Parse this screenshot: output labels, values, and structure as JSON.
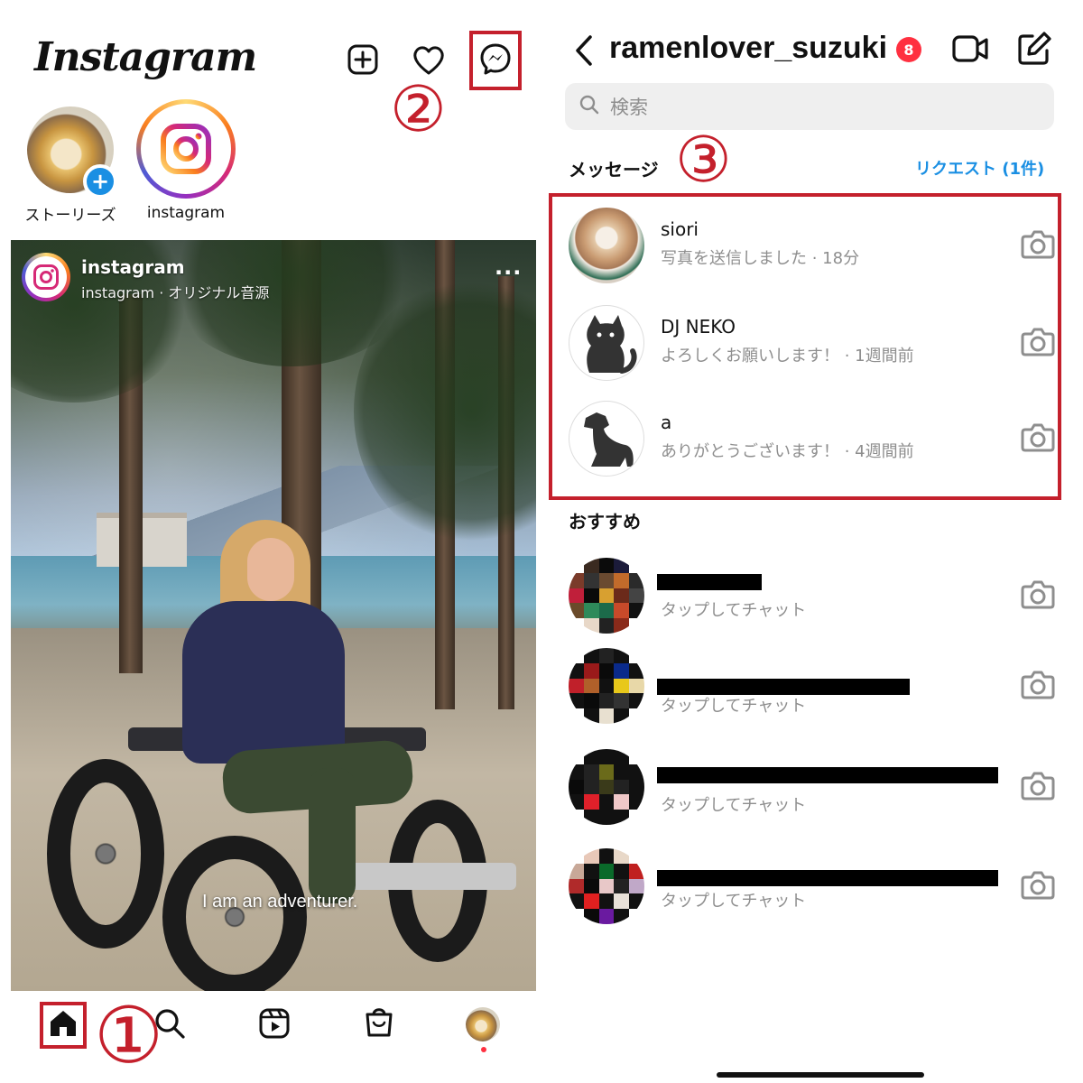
{
  "left": {
    "logo": "Instagram",
    "top_icons": [
      "new-post",
      "notifications",
      "messenger"
    ],
    "stories": [
      {
        "label": "ストーリーズ",
        "type": "own"
      },
      {
        "label": "instagram",
        "type": "account"
      }
    ],
    "post": {
      "username": "instagram",
      "subtitle": "instagram · オリジナル音源",
      "more": "···",
      "caption": "I am an adventurer."
    },
    "bottom_nav": [
      "home",
      "search",
      "reels",
      "shop",
      "profile"
    ],
    "annotations": {
      "one": "①",
      "two": "②"
    }
  },
  "right": {
    "username": "ramenlover_suzuki",
    "badge_count": "8",
    "search_placeholder": "検索",
    "messages_title": "メッセージ",
    "annotation_three": "③",
    "request_link": "リクエスト (1件)",
    "messages": [
      {
        "name": "siori",
        "preview": "写真を送信しました · 18分"
      },
      {
        "name": "DJ NEKO",
        "preview": "よろしくお願いします！ · 1週間前"
      },
      {
        "name": "a",
        "preview": "ありがとうございます！ · 4週間前"
      }
    ],
    "suggested_title": "おすすめ",
    "suggested": [
      {
        "preview": "タップしてチャット"
      },
      {
        "preview": "タップしてチャット"
      },
      {
        "preview": "タップしてチャット"
      },
      {
        "preview": "タップしてチャット"
      }
    ]
  },
  "colors": {
    "annotation_red": "#c4202c",
    "link_blue": "#1a8fe3",
    "badge_red": "#ff3040",
    "secondary_text": "#8e8e8e"
  }
}
